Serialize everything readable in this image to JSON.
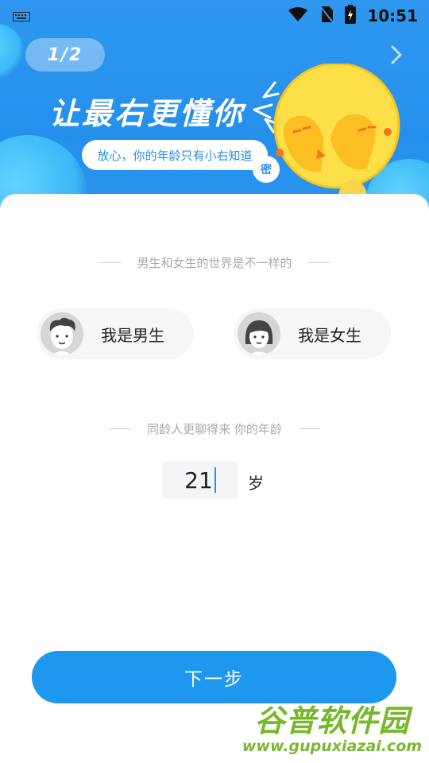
{
  "status_bar": {
    "time": "10:51"
  },
  "header": {
    "progress": "1/2",
    "title": "让最右更懂你",
    "tooltip": "放心，你的年龄只有小右知道",
    "secret_badge": "密"
  },
  "gender_section": {
    "caption": "男生和女生的世界是不一样的",
    "options": [
      {
        "label": "我是男生"
      },
      {
        "label": "我是女生"
      }
    ]
  },
  "age_section": {
    "caption": "同龄人更聊得来 你的年龄",
    "value": "21",
    "unit": "岁"
  },
  "next_button": {
    "label": "下一步"
  },
  "watermark": {
    "title": "谷普软件园",
    "url": "www.gupuxiazai.com"
  },
  "colors": {
    "primary": "#1e97ef",
    "header_bg": "#2f97ef",
    "mascot": "#fde047"
  }
}
